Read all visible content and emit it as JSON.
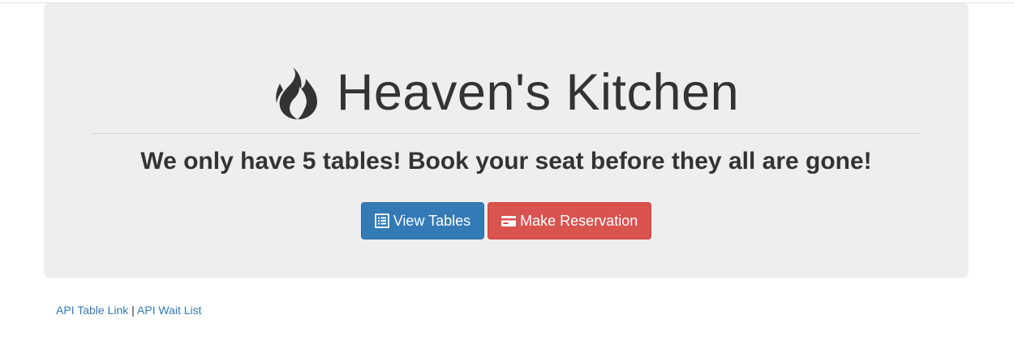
{
  "header": {
    "title": "Heaven's Kitchen",
    "icon": "fire-icon",
    "tagline": "We only have 5 tables! Book your seat before they all are gone!"
  },
  "actions": {
    "view_tables": {
      "label": "View Tables",
      "icon": "list-alt-icon",
      "color": "#337ab7"
    },
    "make_reservation": {
      "label": "Make Reservation",
      "icon": "credit-card-icon",
      "color": "#d9534f"
    }
  },
  "footer": {
    "links": [
      {
        "label": "API Table Link"
      },
      {
        "label": "API Wait List"
      }
    ],
    "separator": "|"
  },
  "colors": {
    "jumbotron_bg": "#eeeeee",
    "link": "#337ab7",
    "text": "#333333"
  }
}
